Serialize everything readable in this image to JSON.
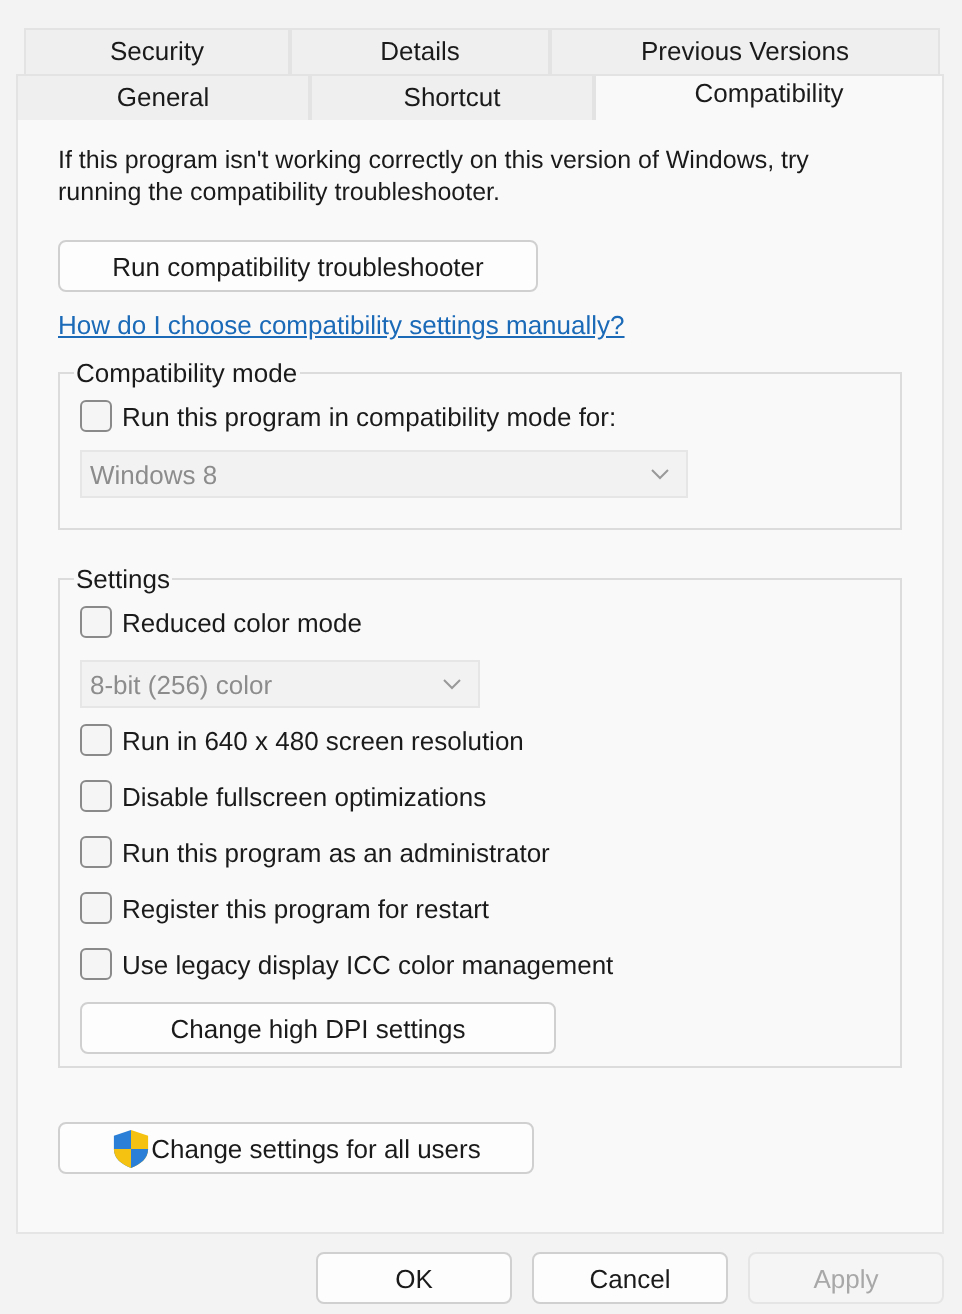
{
  "tab_rows": [
    {
      "tabs": [
        {
          "label": "Security",
          "selected": false
        },
        {
          "label": "Details",
          "selected": false
        },
        {
          "label": "Previous Versions",
          "selected": false
        }
      ]
    },
    {
      "tabs": [
        {
          "label": "General",
          "selected": false
        },
        {
          "label": "Shortcut",
          "selected": false
        },
        {
          "label": "Compatibility",
          "selected": true
        }
      ]
    }
  ],
  "description": "If this program isn't working correctly on this version of Windows, try running the compatibility troubleshooter.",
  "troubleshooter_button": "Run compatibility troubleshooter",
  "help_link": "How do I choose compatibility settings manually?",
  "groups": [
    {
      "title": "Compatibility mode",
      "items": [
        {
          "kind": "checkbox",
          "label": "Run this program in compatibility mode for:",
          "checked": false
        },
        {
          "kind": "dropdown",
          "value": "Windows 8",
          "disabled": true,
          "wide": true
        }
      ]
    },
    {
      "title": "Settings",
      "items": [
        {
          "kind": "checkbox",
          "label": "Reduced color mode",
          "checked": false
        },
        {
          "kind": "dropdown",
          "value": "8-bit (256) color",
          "disabled": true,
          "wide": false
        },
        {
          "kind": "checkbox",
          "label": "Run in 640 x 480 screen resolution",
          "checked": false
        },
        {
          "kind": "checkbox",
          "label": "Disable fullscreen optimizations",
          "checked": false
        },
        {
          "kind": "checkbox",
          "label": "Run this program as an administrator",
          "checked": false
        },
        {
          "kind": "checkbox",
          "label": "Register this program for restart",
          "checked": false
        },
        {
          "kind": "checkbox",
          "label": "Use legacy display ICC color management",
          "checked": false
        },
        {
          "kind": "button",
          "label": "Change high DPI settings"
        }
      ]
    }
  ],
  "all_users_button": "Change settings for all users",
  "buttons": [
    {
      "label": "OK",
      "disabled": false
    },
    {
      "label": "Cancel",
      "disabled": false
    },
    {
      "label": "Apply",
      "disabled": true
    }
  ]
}
